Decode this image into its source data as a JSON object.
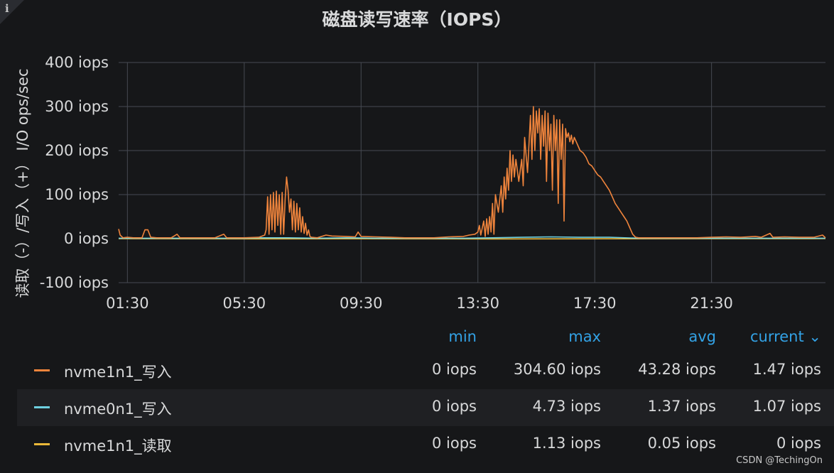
{
  "panel": {
    "title": "磁盘读写速率（IOPS）",
    "info_icon": "i",
    "watermark": "CSDN @TechingOn"
  },
  "colors": {
    "background": "#161719",
    "grid": "#464a52",
    "series_orange": "#ef843c",
    "series_cyan": "#6ed0e0",
    "series_yellow": "#eab839",
    "legend_header": "#33a2e5"
  },
  "legend": {
    "headers": {
      "min": "min",
      "max": "max",
      "avg": "avg",
      "current": "current ⌄"
    },
    "rows": [
      {
        "name": "nvme1n1_写入",
        "color": "#ef843c",
        "min": "0 iops",
        "max": "304.60 iops",
        "avg": "43.28 iops",
        "current": "1.47 iops"
      },
      {
        "name": "nvme0n1_写入",
        "color": "#6ed0e0",
        "min": "0 iops",
        "max": "4.73 iops",
        "avg": "1.37 iops",
        "current": "1.07 iops"
      },
      {
        "name": "nvme1n1_读取",
        "color": "#eab839",
        "min": "0 iops",
        "max": "1.13 iops",
        "avg": "0.05 iops",
        "current": "0 iops"
      }
    ]
  },
  "chart_data": {
    "type": "line",
    "title": "磁盘读写速率（IOPS）",
    "ylabel": "读取（-）/写入（+） I/O ops/sec",
    "xlabel": "",
    "ylim": [
      -100,
      400
    ],
    "yticks": [
      "-100 iops",
      "0 iops",
      "100 iops",
      "200 iops",
      "300 iops",
      "400 iops"
    ],
    "ytick_values": [
      -100,
      0,
      100,
      200,
      300,
      400
    ],
    "xticks": [
      "01:30",
      "05:30",
      "09:30",
      "13:30",
      "17:30",
      "21:30"
    ],
    "xtick_values": [
      1.5,
      5.5,
      9.5,
      13.5,
      17.5,
      21.5
    ],
    "xlim": [
      1.2,
      25.4
    ],
    "grid": true,
    "series": [
      {
        "name": "nvme1n1_写入",
        "color": "#ef843c",
        "points": [
          [
            1.2,
            22
          ],
          [
            1.25,
            8
          ],
          [
            1.35,
            2
          ],
          [
            1.5,
            3
          ],
          [
            1.7,
            2
          ],
          [
            2.0,
            2
          ],
          [
            2.1,
            20
          ],
          [
            2.2,
            20
          ],
          [
            2.3,
            3
          ],
          [
            2.5,
            2
          ],
          [
            3.0,
            2
          ],
          [
            3.2,
            10
          ],
          [
            3.3,
            2
          ],
          [
            4.0,
            2
          ],
          [
            4.5,
            2
          ],
          [
            4.8,
            10
          ],
          [
            4.9,
            2
          ],
          [
            5.5,
            2
          ],
          [
            6.0,
            3
          ],
          [
            6.2,
            8
          ],
          [
            6.25,
            20
          ],
          [
            6.3,
            95
          ],
          [
            6.35,
            10
          ],
          [
            6.4,
            100
          ],
          [
            6.45,
            20
          ],
          [
            6.5,
            105
          ],
          [
            6.55,
            15
          ],
          [
            6.6,
            108
          ],
          [
            6.65,
            30
          ],
          [
            6.7,
            100
          ],
          [
            6.75,
            10
          ],
          [
            6.8,
            105
          ],
          [
            6.85,
            10
          ],
          [
            6.9,
            90
          ],
          [
            6.95,
            140
          ],
          [
            7.0,
            110
          ],
          [
            7.05,
            60
          ],
          [
            7.1,
            90
          ],
          [
            7.15,
            20
          ],
          [
            7.2,
            85
          ],
          [
            7.25,
            15
          ],
          [
            7.3,
            80
          ],
          [
            7.35,
            20
          ],
          [
            7.4,
            70
          ],
          [
            7.45,
            15
          ],
          [
            7.5,
            50
          ],
          [
            7.55,
            12
          ],
          [
            7.6,
            35
          ],
          [
            7.65,
            8
          ],
          [
            7.7,
            20
          ],
          [
            7.75,
            5
          ],
          [
            7.8,
            3
          ],
          [
            8.0,
            2
          ],
          [
            8.3,
            8
          ],
          [
            8.5,
            6
          ],
          [
            9.0,
            5
          ],
          [
            9.3,
            4
          ],
          [
            9.4,
            15
          ],
          [
            9.5,
            5
          ],
          [
            10.0,
            4
          ],
          [
            10.5,
            3
          ],
          [
            11.0,
            2
          ],
          [
            11.5,
            2
          ],
          [
            12.0,
            2
          ],
          [
            12.5,
            4
          ],
          [
            13.0,
            5
          ],
          [
            13.2,
            8
          ],
          [
            13.4,
            10
          ],
          [
            13.5,
            15
          ],
          [
            13.55,
            30
          ],
          [
            13.6,
            8
          ],
          [
            13.7,
            40
          ],
          [
            13.75,
            5
          ],
          [
            13.8,
            45
          ],
          [
            13.85,
            10
          ],
          [
            13.9,
            50
          ],
          [
            13.95,
            15
          ],
          [
            14.0,
            80
          ],
          [
            14.05,
            10
          ],
          [
            14.1,
            100
          ],
          [
            14.2,
            60
          ],
          [
            14.3,
            120
          ],
          [
            14.35,
            60
          ],
          [
            14.4,
            140
          ],
          [
            14.45,
            90
          ],
          [
            14.5,
            160
          ],
          [
            14.55,
            110
          ],
          [
            14.6,
            200
          ],
          [
            14.65,
            130
          ],
          [
            14.7,
            190
          ],
          [
            14.75,
            140
          ],
          [
            14.8,
            180
          ],
          [
            14.9,
            130
          ],
          [
            15.0,
            180
          ],
          [
            15.05,
            120
          ],
          [
            15.1,
            230
          ],
          [
            15.2,
            150
          ],
          [
            15.3,
            280
          ],
          [
            15.35,
            180
          ],
          [
            15.4,
            300
          ],
          [
            15.45,
            200
          ],
          [
            15.5,
            290
          ],
          [
            15.55,
            240
          ],
          [
            15.6,
            295
          ],
          [
            15.65,
            180
          ],
          [
            15.7,
            280
          ],
          [
            15.75,
            210
          ],
          [
            15.8,
            290
          ],
          [
            15.85,
            130
          ],
          [
            15.9,
            285
          ],
          [
            15.95,
            200
          ],
          [
            16.0,
            260
          ],
          [
            16.05,
            110
          ],
          [
            16.1,
            280
          ],
          [
            16.15,
            200
          ],
          [
            16.2,
            270
          ],
          [
            16.25,
            80
          ],
          [
            16.3,
            270
          ],
          [
            16.35,
            180
          ],
          [
            16.4,
            260
          ],
          [
            16.45,
            40
          ],
          [
            16.5,
            250
          ],
          [
            16.55,
            230
          ],
          [
            16.6,
            240
          ],
          [
            16.65,
            220
          ],
          [
            16.7,
            235
          ],
          [
            16.75,
            215
          ],
          [
            16.8,
            230
          ],
          [
            16.9,
            215
          ],
          [
            17.0,
            200
          ],
          [
            17.1,
            195
          ],
          [
            17.2,
            185
          ],
          [
            17.3,
            170
          ],
          [
            17.4,
            165
          ],
          [
            17.5,
            155
          ],
          [
            17.6,
            145
          ],
          [
            17.7,
            140
          ],
          [
            17.8,
            130
          ],
          [
            17.9,
            120
          ],
          [
            18.0,
            110
          ],
          [
            18.1,
            95
          ],
          [
            18.2,
            80
          ],
          [
            18.3,
            70
          ],
          [
            18.4,
            60
          ],
          [
            18.5,
            50
          ],
          [
            18.6,
            40
          ],
          [
            18.7,
            25
          ],
          [
            18.8,
            10
          ],
          [
            18.9,
            3
          ],
          [
            19.0,
            2
          ],
          [
            20.0,
            2
          ],
          [
            21.0,
            2
          ],
          [
            21.5,
            3
          ],
          [
            22.0,
            4
          ],
          [
            22.5,
            3
          ],
          [
            23.0,
            5
          ],
          [
            23.2,
            3
          ],
          [
            23.5,
            12
          ],
          [
            23.6,
            3
          ],
          [
            24.0,
            4
          ],
          [
            24.5,
            3
          ],
          [
            25.0,
            3
          ],
          [
            25.3,
            8
          ],
          [
            25.4,
            2
          ]
        ]
      },
      {
        "name": "nvme0n1_写入",
        "color": "#6ed0e0",
        "points": [
          [
            1.2,
            1
          ],
          [
            5.5,
            1
          ],
          [
            6.0,
            2
          ],
          [
            7.0,
            2
          ],
          [
            8.0,
            1
          ],
          [
            9.0,
            2
          ],
          [
            10.0,
            1
          ],
          [
            13.0,
            1
          ],
          [
            14.0,
            2
          ],
          [
            15.0,
            3
          ],
          [
            16.0,
            4
          ],
          [
            17.0,
            3
          ],
          [
            18.0,
            3
          ],
          [
            19.0,
            1
          ],
          [
            22.0,
            1
          ],
          [
            25.4,
            1
          ]
        ]
      },
      {
        "name": "nvme1n1_读取",
        "color": "#eab839",
        "points": [
          [
            1.2,
            -0.2
          ],
          [
            6.0,
            -0.5
          ],
          [
            9.0,
            -0.3
          ],
          [
            14.0,
            -0.6
          ],
          [
            18.0,
            -0.4
          ],
          [
            22.0,
            -0.2
          ],
          [
            25.4,
            0
          ]
        ]
      }
    ]
  }
}
